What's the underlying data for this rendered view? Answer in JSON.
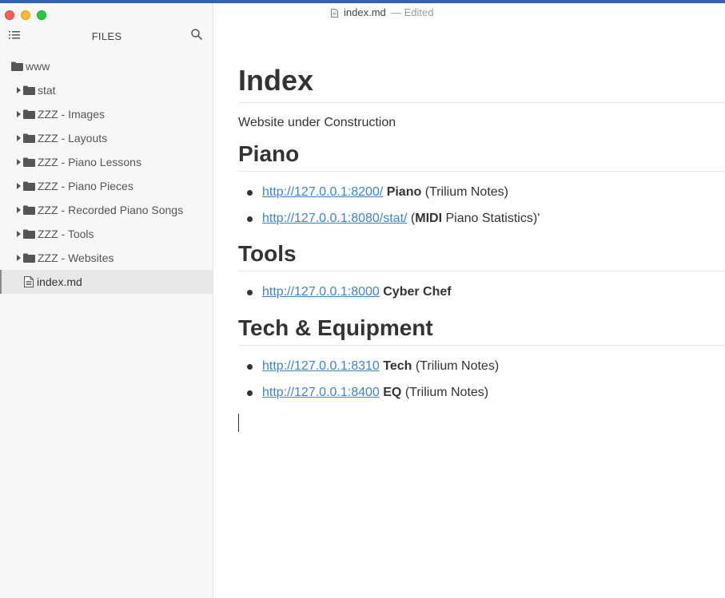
{
  "window": {
    "file_name": "index.md",
    "edited_suffix": "— Edited"
  },
  "sidebar": {
    "title": "FILES",
    "icons": {
      "outline": "outline-list-icon",
      "search": "search-icon"
    },
    "root": {
      "label": "www"
    },
    "folders": [
      {
        "label": "stat"
      },
      {
        "label": "ZZZ - Images"
      },
      {
        "label": "ZZZ - Layouts"
      },
      {
        "label": "ZZZ - Piano Lessons"
      },
      {
        "label": "ZZZ - Piano Pieces"
      },
      {
        "label": "ZZZ - Recorded Piano Songs"
      },
      {
        "label": "ZZZ - Tools"
      },
      {
        "label": "ZZZ - Websites"
      }
    ],
    "selected_file": {
      "label": "index.md"
    }
  },
  "document": {
    "title": "Index",
    "subtitle": "Website under Construction",
    "sections": [
      {
        "heading": "Piano",
        "items": [
          {
            "link": "http://127.0.0.1:8200/",
            "parts": [
              " ",
              {
                "bold": "Piano"
              },
              " (Trilium Notes)"
            ]
          },
          {
            "link": "http://127.0.0.1:8080/stat/",
            "parts": [
              " (",
              {
                "bold": "MIDI"
              },
              " Piano Statistics)'"
            ]
          }
        ]
      },
      {
        "heading": "Tools",
        "items": [
          {
            "link": "http://127.0.0.1:8000",
            "parts": [
              " ",
              {
                "bold": "Cyber Chef"
              }
            ]
          }
        ]
      },
      {
        "heading": "Tech & Equipment",
        "items": [
          {
            "link": "http://127.0.0.1:8310",
            "parts": [
              " ",
              {
                "bold": "Tech"
              },
              " (Trilium Notes)"
            ]
          },
          {
            "link": "http://127.0.0.1:8400",
            "parts": [
              " ",
              {
                "bold": "EQ"
              },
              " (Trilium Notes)"
            ]
          }
        ]
      }
    ]
  },
  "colors": {
    "link": "#4183c4",
    "sidebar_bg": "#f7f7f7",
    "selected_row_bg": "#e8e8e8",
    "close": "#fc5f57",
    "minimize": "#fdbc2e",
    "maximize": "#28c840"
  }
}
